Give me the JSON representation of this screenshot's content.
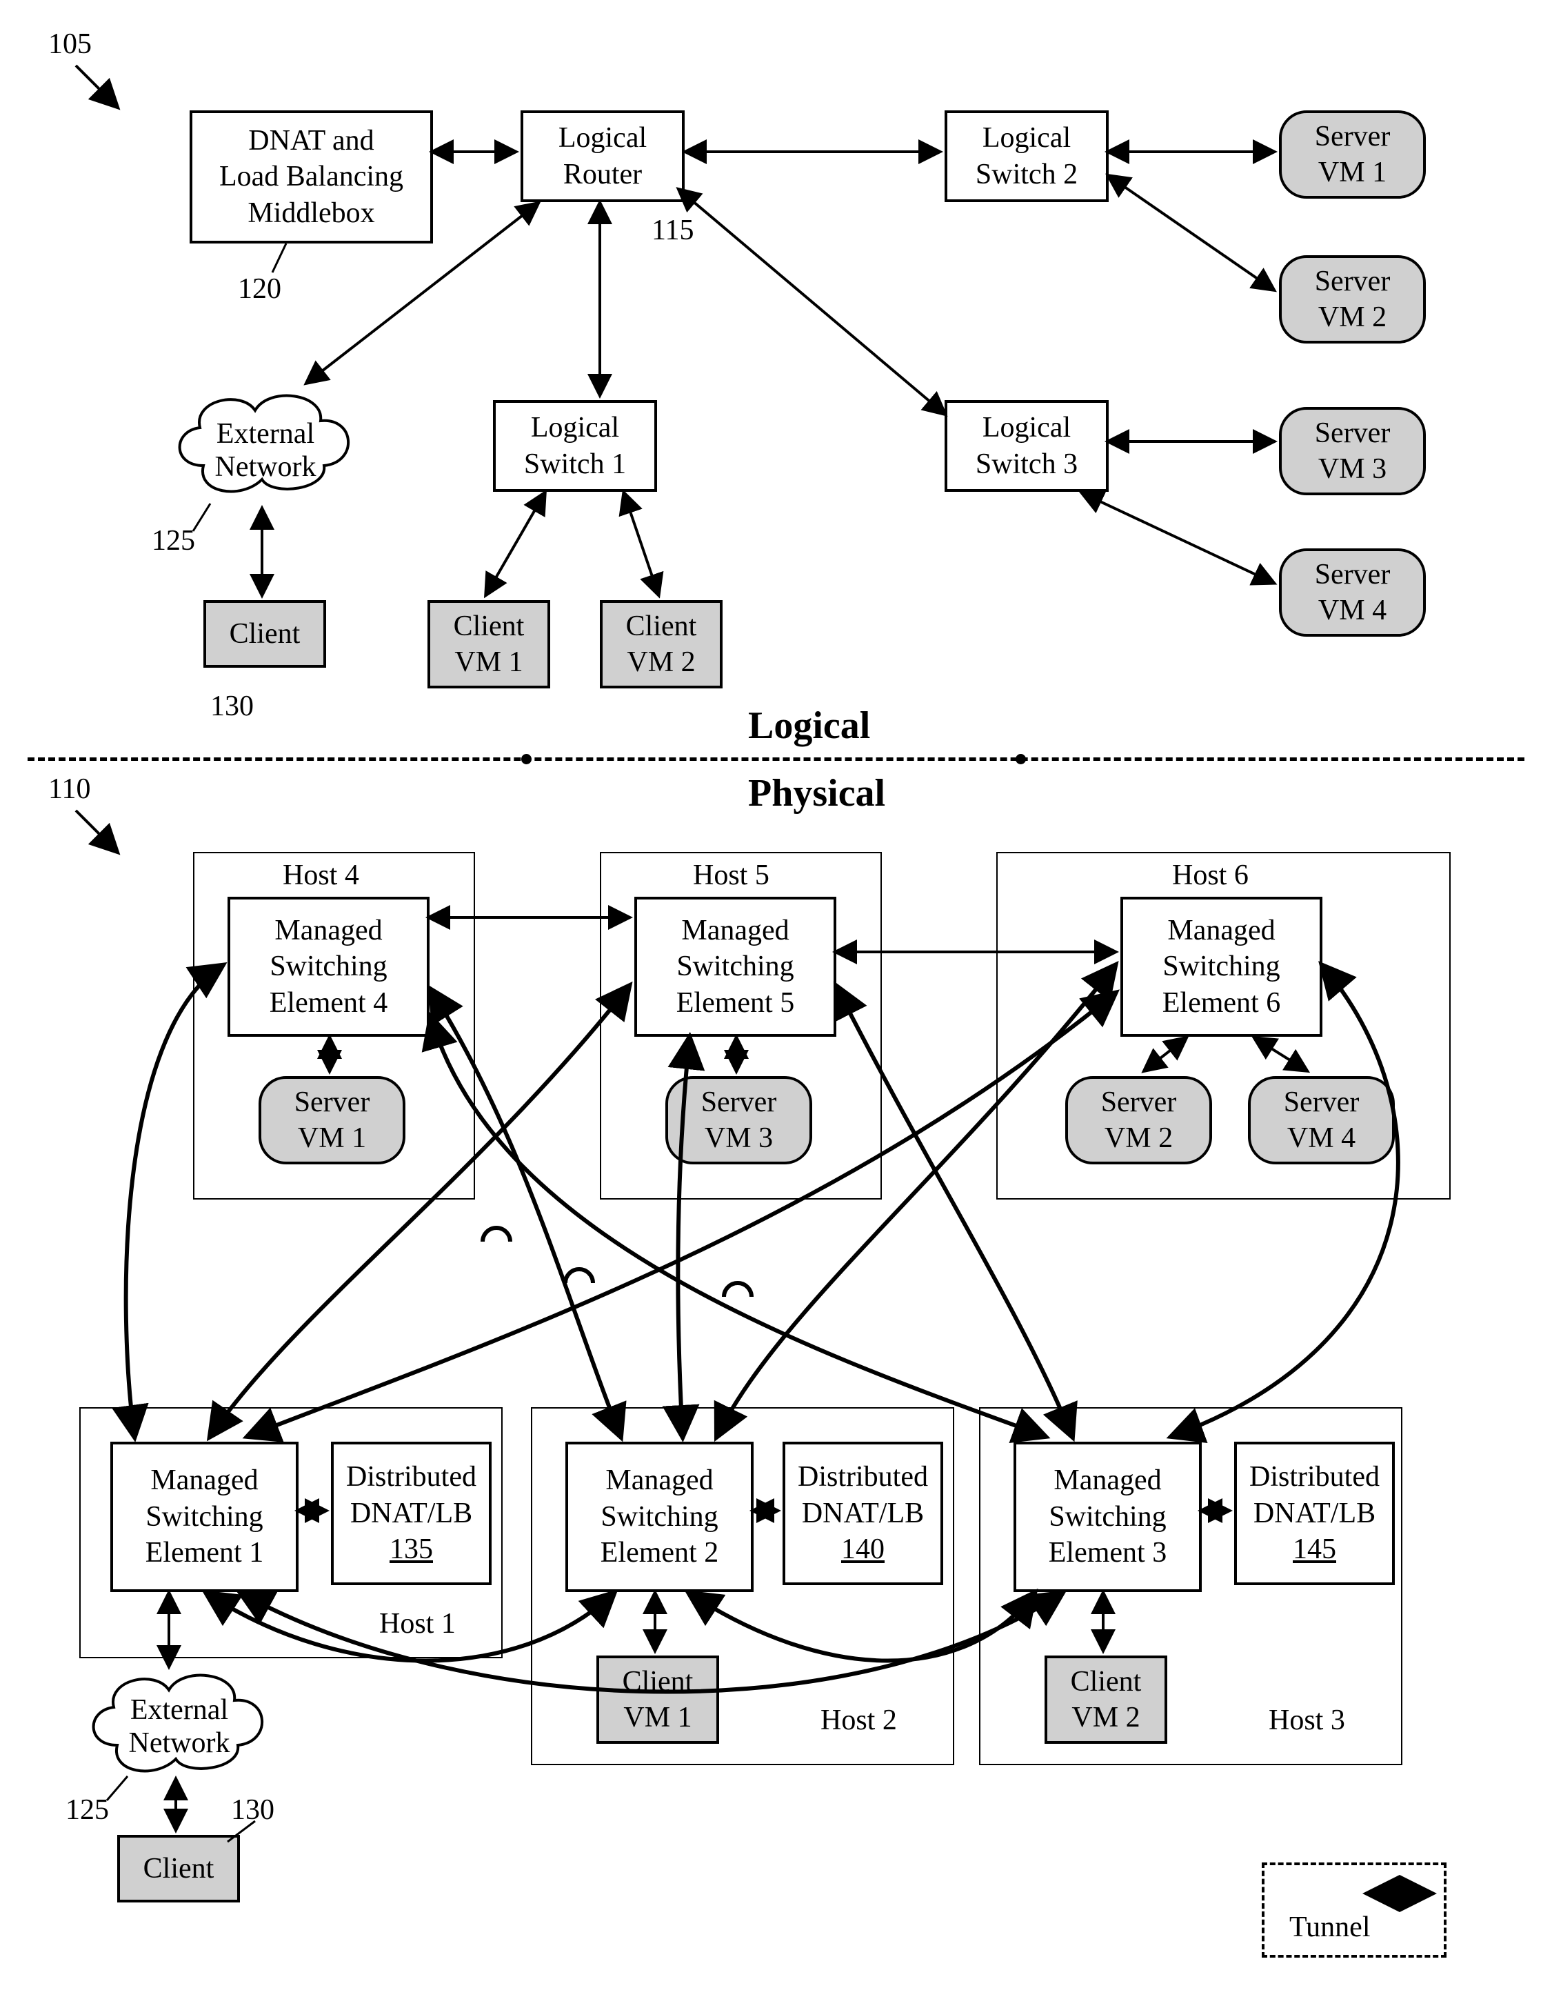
{
  "refs": {
    "r105": "105",
    "r110": "110",
    "r115": "115",
    "r120": "120",
    "r125a": "125",
    "r125b": "125",
    "r130a": "130",
    "r130b": "130",
    "r135": "135",
    "r140": "140",
    "r145": "145"
  },
  "headers": {
    "logical": "Logical",
    "physical": "Physical"
  },
  "logical": {
    "dnat": "DNAT and\nLoad Balancing\nMiddlebox",
    "router": "Logical\nRouter",
    "sw1": "Logical\nSwitch 1",
    "sw2": "Logical\nSwitch 2",
    "sw3": "Logical\nSwitch 3",
    "extnet": "External\nNetwork",
    "client": "Client",
    "cvm1": "Client\nVM 1",
    "cvm2": "Client\nVM 2",
    "svm1": "Server\nVM 1",
    "svm2": "Server\nVM 2",
    "svm3": "Server\nVM 3",
    "svm4": "Server\nVM 4"
  },
  "physical": {
    "host1": "Host 1",
    "host2": "Host 2",
    "host3": "Host 3",
    "host4": "Host 4",
    "host5": "Host 5",
    "host6": "Host 6",
    "mse1": "Managed\nSwitching\nElement 1",
    "mse2": "Managed\nSwitching\nElement 2",
    "mse3": "Managed\nSwitching\nElement 3",
    "mse4": "Managed\nSwitching\nElement 4",
    "mse5": "Managed\nSwitching\nElement 5",
    "mse6": "Managed\nSwitching\nElement 6",
    "dist": "Distributed\nDNAT/LB",
    "svm1": "Server\nVM 1",
    "svm2": "Server\nVM 2",
    "svm3": "Server\nVM 3",
    "svm4": "Server\nVM 4",
    "extnet": "External\nNetwork",
    "client": "Client",
    "cvm1": "Client\nVM 1",
    "cvm2": "Client\nVM 2",
    "tunnel": "Tunnel"
  }
}
